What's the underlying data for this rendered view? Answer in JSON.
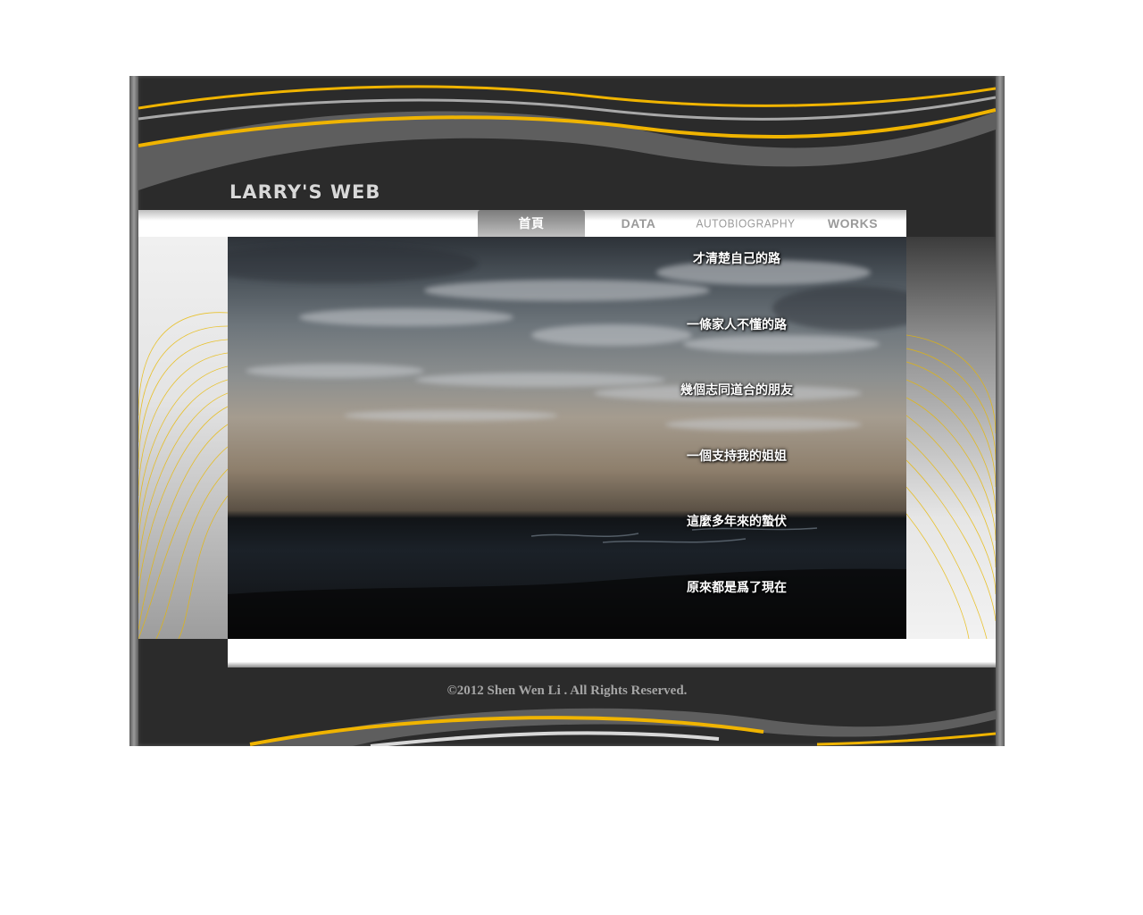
{
  "site": {
    "logo_text": "LARRY'S WEB"
  },
  "nav": {
    "items": [
      {
        "label": "首頁",
        "active": true
      },
      {
        "label": "DATA",
        "active": false
      },
      {
        "label": "AUTOBIOGRAPHY",
        "active": false
      },
      {
        "label": "WORKS",
        "active": false
      }
    ]
  },
  "hero": {
    "lines": [
      "才清楚自己的路",
      "一條家人不懂的路",
      "幾個志同道合的朋友",
      "一個支持我的姐姐",
      "這麼多年來的蟄伏",
      "原來都是爲了現在"
    ]
  },
  "footer": {
    "copyright": "©2012 Shen Wen Li .  All Rights Reserved."
  },
  "colors": {
    "frame": "#2b2b2b",
    "accent_gold": "#f0b400",
    "swoosh_gray": "#6a6a6a",
    "nav_text": "#9a9a9a"
  }
}
